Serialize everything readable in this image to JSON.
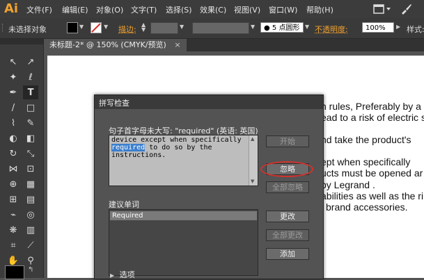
{
  "app": {
    "logo": "Ai"
  },
  "menu": [
    "文件(F)",
    "编辑(E)",
    "对象(O)",
    "文字(T)",
    "选择(S)",
    "效果(C)",
    "视图(V)",
    "窗口(W)",
    "帮助(H)"
  ],
  "control_bar": {
    "selection": "未选择对象",
    "stroke_label": "描边:",
    "brush_size": "5",
    "brush_shape": "点圆形",
    "opacity_label": "不透明度:",
    "opacity_value": "100%",
    "style_label": "样式:"
  },
  "document_tab": {
    "title": "未标题-2* @ 150% (CMYK/预览)",
    "close": "×"
  },
  "document_text": [
    "n rules,  Preferably by a",
    "ead to a risk of electric s",
    "nd take the product's",
    "ept when specifically",
    "ucts must be opened ar",
    "by Legrand .",
    "abilities as well as the ri",
    "l brand accessories."
  ],
  "dialog": {
    "title": "拼写检查",
    "issue_label": "句子首字母未大写: \"required\" (英语: 英国)",
    "context_lines": [
      "device except when specifically",
      "required",
      " to do so by the",
      "instructions."
    ],
    "suggestions_label": "建议单词",
    "suggestions": [
      "Required"
    ],
    "buttons": {
      "start": "开始",
      "ignore": "忽略",
      "ignore_all": "全部忽略",
      "change": "更改",
      "change_all": "全部更改",
      "add": "添加"
    },
    "options_label": "选项"
  },
  "colors": {
    "highlight": "#3c7fcd",
    "annotation_ring": "#d4312c",
    "opacity_label": "#f2a22f"
  }
}
